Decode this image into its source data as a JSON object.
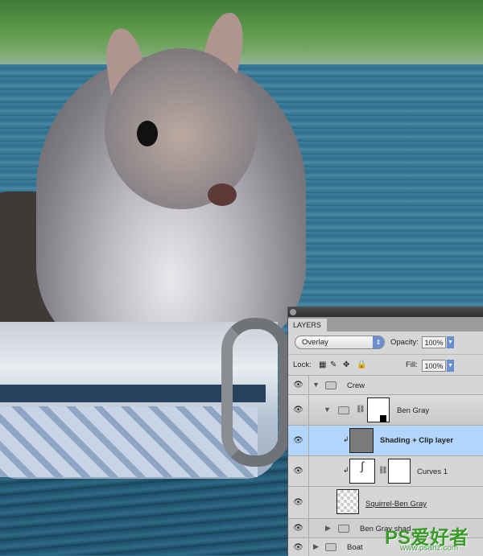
{
  "panel": {
    "tab": "LAYERS",
    "blend_mode": "Overlay",
    "opacity_label": "Opacity:",
    "opacity": "100%",
    "lock_label": "Lock:",
    "fill_label": "Fill:",
    "fill": "100%",
    "layers": [
      {
        "name": "Crew",
        "type": "group",
        "expanded": true
      },
      {
        "name": "Ben Gray",
        "type": "group",
        "expanded": true
      },
      {
        "name": "Shading + Clip layer",
        "type": "layer",
        "selected": true
      },
      {
        "name": "Curves 1",
        "type": "adjustment"
      },
      {
        "name": "Squirrel-Ben Gray",
        "type": "smart-object"
      },
      {
        "name": "Ben Gray shad",
        "type": "group",
        "expanded": false
      },
      {
        "name": "Boat",
        "type": "group",
        "expanded": false
      }
    ],
    "selection_color": "#b3d5fb"
  },
  "watermark": {
    "logo": "PS爱好者",
    "url": "www.psahz.com"
  }
}
